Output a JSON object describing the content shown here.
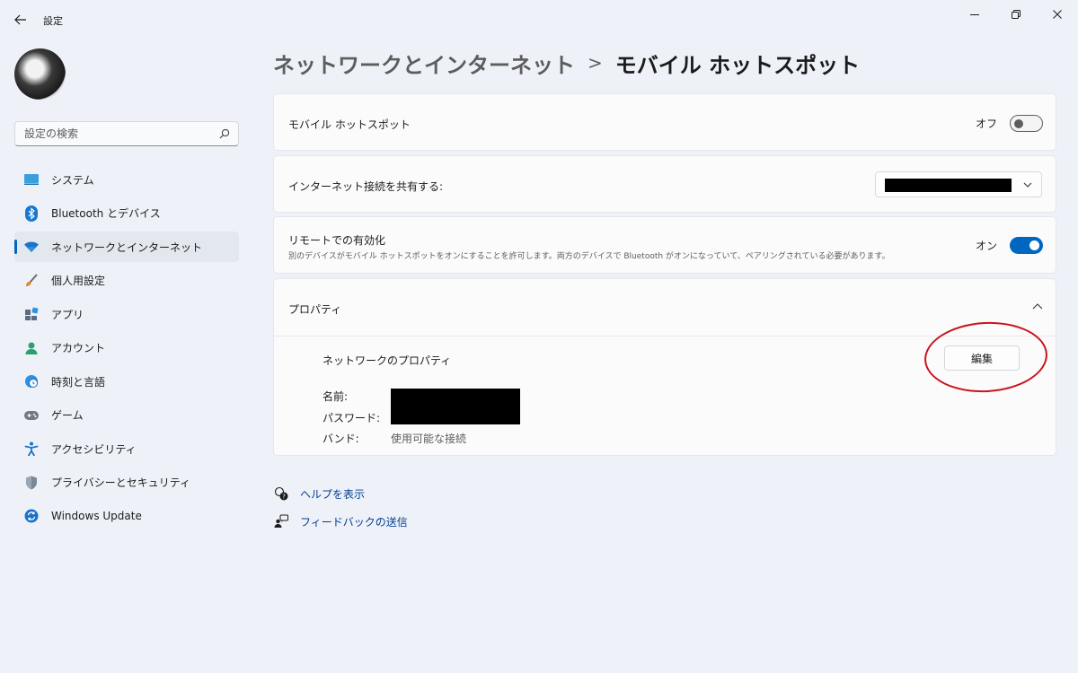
{
  "window": {
    "title": "設定",
    "back_icon": "back-arrow-icon",
    "controls": [
      "minimize-icon",
      "restore-icon",
      "close-icon"
    ]
  },
  "search": {
    "placeholder": "設定の検索",
    "value": ""
  },
  "sidebar": {
    "items": [
      {
        "label": "システム",
        "icon": "system-icon",
        "active": false
      },
      {
        "label": "Bluetooth とデバイス",
        "icon": "bluetooth-icon",
        "active": false
      },
      {
        "label": "ネットワークとインターネット",
        "icon": "wifi-icon",
        "active": true
      },
      {
        "label": "個人用設定",
        "icon": "brush-icon",
        "active": false
      },
      {
        "label": "アプリ",
        "icon": "apps-icon",
        "active": false
      },
      {
        "label": "アカウント",
        "icon": "account-icon",
        "active": false
      },
      {
        "label": "時刻と言語",
        "icon": "globe-clock-icon",
        "active": false
      },
      {
        "label": "ゲーム",
        "icon": "gamepad-icon",
        "active": false
      },
      {
        "label": "アクセシビリティ",
        "icon": "accessibility-icon",
        "active": false
      },
      {
        "label": "プライバシーとセキュリティ",
        "icon": "shield-icon",
        "active": false
      },
      {
        "label": "Windows Update",
        "icon": "windows-update-icon",
        "active": false
      }
    ]
  },
  "breadcrumb": {
    "parent": "ネットワークとインターネット",
    "separator": ">",
    "current": "モバイル ホットスポット"
  },
  "hotspot": {
    "label": "モバイル ホットスポット",
    "state": "オフ",
    "on": false
  },
  "share": {
    "label": "インターネット接続を共有する:",
    "value_redacted": true
  },
  "remote": {
    "label": "リモートでの有効化",
    "description": "別のデバイスがモバイル ホットスポットをオンにすることを許可します。両方のデバイスで Bluetooth がオンになっていて、ペアリングされている必要があります。",
    "state": "オン",
    "on": true
  },
  "properties": {
    "title": "プロパティ",
    "expanded": true,
    "network_label": "ネットワークのプロパティ",
    "edit_label": "編集",
    "name_key": "名前:",
    "password_key": "パスワード:",
    "band_key": "バンド:",
    "band_value": "使用可能な接続"
  },
  "links": {
    "help": "ヘルプを表示",
    "feedback": "フィードバックの送信"
  },
  "colors": {
    "accent": "#0067c0",
    "background": "#eef2f8",
    "card": "#fbfbfc",
    "annotation": "#c8161d",
    "link": "#003e92"
  }
}
